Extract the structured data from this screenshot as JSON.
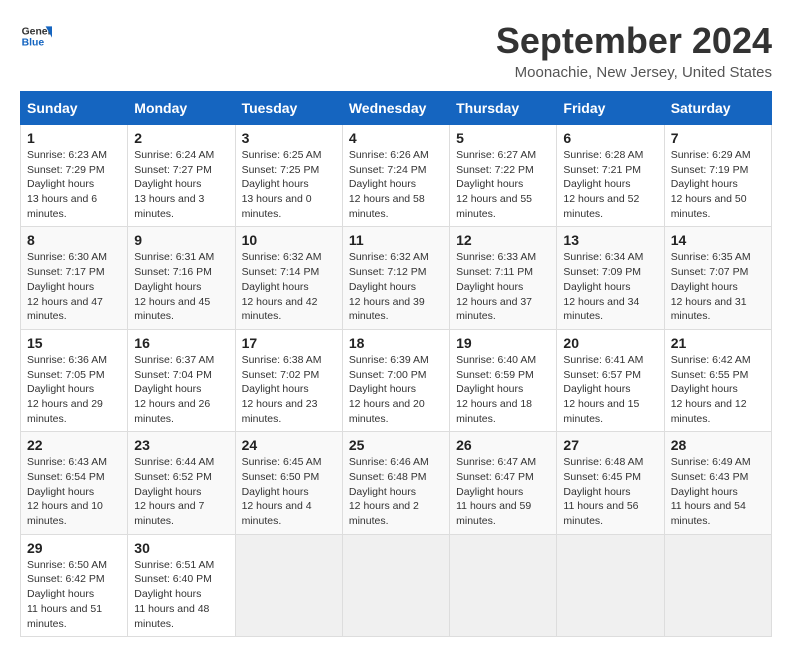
{
  "logo": {
    "line1": "General",
    "line2": "Blue"
  },
  "title": "September 2024",
  "subtitle": "Moonachie, New Jersey, United States",
  "days_of_week": [
    "Sunday",
    "Monday",
    "Tuesday",
    "Wednesday",
    "Thursday",
    "Friday",
    "Saturday"
  ],
  "weeks": [
    [
      {
        "day": "1",
        "sunrise": "6:23 AM",
        "sunset": "7:29 PM",
        "daylight": "13 hours and 6 minutes."
      },
      {
        "day": "2",
        "sunrise": "6:24 AM",
        "sunset": "7:27 PM",
        "daylight": "13 hours and 3 minutes."
      },
      {
        "day": "3",
        "sunrise": "6:25 AM",
        "sunset": "7:25 PM",
        "daylight": "13 hours and 0 minutes."
      },
      {
        "day": "4",
        "sunrise": "6:26 AM",
        "sunset": "7:24 PM",
        "daylight": "12 hours and 58 minutes."
      },
      {
        "day": "5",
        "sunrise": "6:27 AM",
        "sunset": "7:22 PM",
        "daylight": "12 hours and 55 minutes."
      },
      {
        "day": "6",
        "sunrise": "6:28 AM",
        "sunset": "7:21 PM",
        "daylight": "12 hours and 52 minutes."
      },
      {
        "day": "7",
        "sunrise": "6:29 AM",
        "sunset": "7:19 PM",
        "daylight": "12 hours and 50 minutes."
      }
    ],
    [
      {
        "day": "8",
        "sunrise": "6:30 AM",
        "sunset": "7:17 PM",
        "daylight": "12 hours and 47 minutes."
      },
      {
        "day": "9",
        "sunrise": "6:31 AM",
        "sunset": "7:16 PM",
        "daylight": "12 hours and 45 minutes."
      },
      {
        "day": "10",
        "sunrise": "6:32 AM",
        "sunset": "7:14 PM",
        "daylight": "12 hours and 42 minutes."
      },
      {
        "day": "11",
        "sunrise": "6:32 AM",
        "sunset": "7:12 PM",
        "daylight": "12 hours and 39 minutes."
      },
      {
        "day": "12",
        "sunrise": "6:33 AM",
        "sunset": "7:11 PM",
        "daylight": "12 hours and 37 minutes."
      },
      {
        "day": "13",
        "sunrise": "6:34 AM",
        "sunset": "7:09 PM",
        "daylight": "12 hours and 34 minutes."
      },
      {
        "day": "14",
        "sunrise": "6:35 AM",
        "sunset": "7:07 PM",
        "daylight": "12 hours and 31 minutes."
      }
    ],
    [
      {
        "day": "15",
        "sunrise": "6:36 AM",
        "sunset": "7:05 PM",
        "daylight": "12 hours and 29 minutes."
      },
      {
        "day": "16",
        "sunrise": "6:37 AM",
        "sunset": "7:04 PM",
        "daylight": "12 hours and 26 minutes."
      },
      {
        "day": "17",
        "sunrise": "6:38 AM",
        "sunset": "7:02 PM",
        "daylight": "12 hours and 23 minutes."
      },
      {
        "day": "18",
        "sunrise": "6:39 AM",
        "sunset": "7:00 PM",
        "daylight": "12 hours and 20 minutes."
      },
      {
        "day": "19",
        "sunrise": "6:40 AM",
        "sunset": "6:59 PM",
        "daylight": "12 hours and 18 minutes."
      },
      {
        "day": "20",
        "sunrise": "6:41 AM",
        "sunset": "6:57 PM",
        "daylight": "12 hours and 15 minutes."
      },
      {
        "day": "21",
        "sunrise": "6:42 AM",
        "sunset": "6:55 PM",
        "daylight": "12 hours and 12 minutes."
      }
    ],
    [
      {
        "day": "22",
        "sunrise": "6:43 AM",
        "sunset": "6:54 PM",
        "daylight": "12 hours and 10 minutes."
      },
      {
        "day": "23",
        "sunrise": "6:44 AM",
        "sunset": "6:52 PM",
        "daylight": "12 hours and 7 minutes."
      },
      {
        "day": "24",
        "sunrise": "6:45 AM",
        "sunset": "6:50 PM",
        "daylight": "12 hours and 4 minutes."
      },
      {
        "day": "25",
        "sunrise": "6:46 AM",
        "sunset": "6:48 PM",
        "daylight": "12 hours and 2 minutes."
      },
      {
        "day": "26",
        "sunrise": "6:47 AM",
        "sunset": "6:47 PM",
        "daylight": "11 hours and 59 minutes."
      },
      {
        "day": "27",
        "sunrise": "6:48 AM",
        "sunset": "6:45 PM",
        "daylight": "11 hours and 56 minutes."
      },
      {
        "day": "28",
        "sunrise": "6:49 AM",
        "sunset": "6:43 PM",
        "daylight": "11 hours and 54 minutes."
      }
    ],
    [
      {
        "day": "29",
        "sunrise": "6:50 AM",
        "sunset": "6:42 PM",
        "daylight": "11 hours and 51 minutes."
      },
      {
        "day": "30",
        "sunrise": "6:51 AM",
        "sunset": "6:40 PM",
        "daylight": "11 hours and 48 minutes."
      },
      null,
      null,
      null,
      null,
      null
    ]
  ]
}
